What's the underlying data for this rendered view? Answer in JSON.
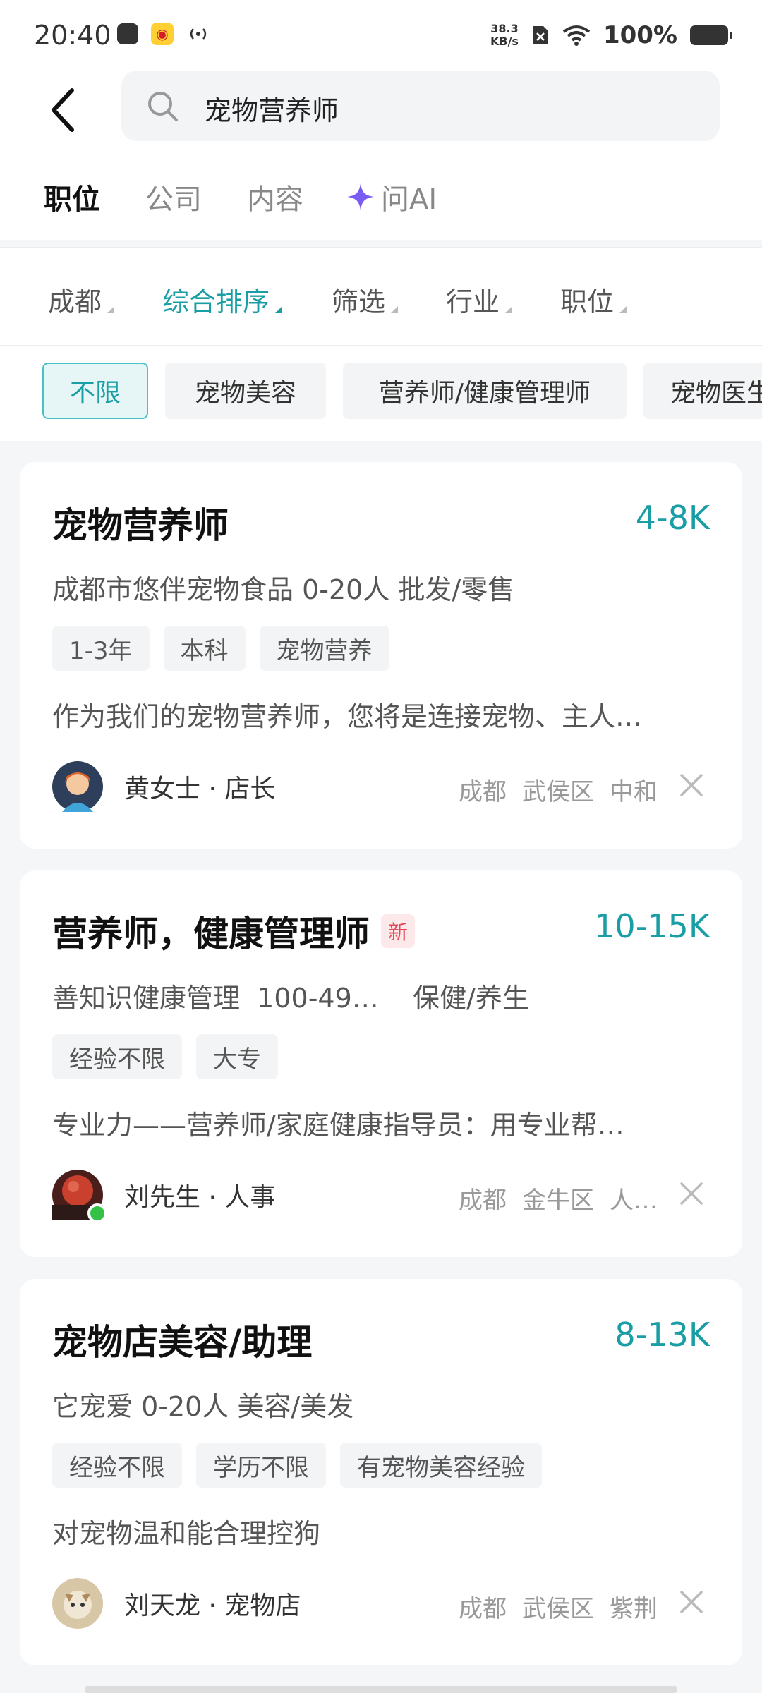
{
  "status": {
    "time": "20:40",
    "net_speed_top": "38.3",
    "net_speed_bottom": "KB/s",
    "battery": "100%"
  },
  "search": {
    "query": "宠物营养师"
  },
  "tabs": [
    {
      "label": "职位"
    },
    {
      "label": "公司"
    },
    {
      "label": "内容"
    },
    {
      "label": "问AI"
    }
  ],
  "filters": [
    {
      "label": "成都"
    },
    {
      "label": "综合排序"
    },
    {
      "label": "筛选"
    },
    {
      "label": "行业"
    },
    {
      "label": "职位"
    }
  ],
  "chips": [
    {
      "label": "不限"
    },
    {
      "label": "宠物美容"
    },
    {
      "label": "营养师/健康管理师"
    },
    {
      "label": "宠物医生"
    }
  ],
  "jobs": [
    {
      "title": "宠物营养师",
      "salary": "4-8K",
      "company": "成都市悠伴宠物食品  0-20人  批发/零售",
      "tags": [
        "1-3年",
        "本科",
        "宠物营养"
      ],
      "description": "作为我们的宠物营养师，您将是连接宠物、主人…",
      "recruiter": "黄女士 · 店长",
      "location": [
        "成都",
        "武侯区",
        "中和"
      ]
    },
    {
      "title": "营养师，健康管理师",
      "badge": "新",
      "salary": "10-15K",
      "company": "善知识健康管理  100-49…    保健/养生",
      "tags": [
        "经验不限",
        "大专"
      ],
      "description": "专业力——营养师/家庭健康指导员：用专业帮…",
      "recruiter": "刘先生 · 人事",
      "location": [
        "成都",
        "金牛区",
        "人…"
      ]
    },
    {
      "title": "宠物店美容/助理",
      "salary": "8-13K",
      "company": "它宠爱  0-20人  美容/美发",
      "tags": [
        "经验不限",
        "学历不限",
        "有宠物美容经验"
      ],
      "description": "对宠物温和能合理控狗",
      "recruiter": "刘天龙 · 宠物店",
      "location": [
        "成都",
        "武侯区",
        "紫荆"
      ]
    }
  ],
  "colors": {
    "accent": "#1a9ea5",
    "new_badge": "#e24a5a",
    "ai_star": "#7a5cf5"
  }
}
